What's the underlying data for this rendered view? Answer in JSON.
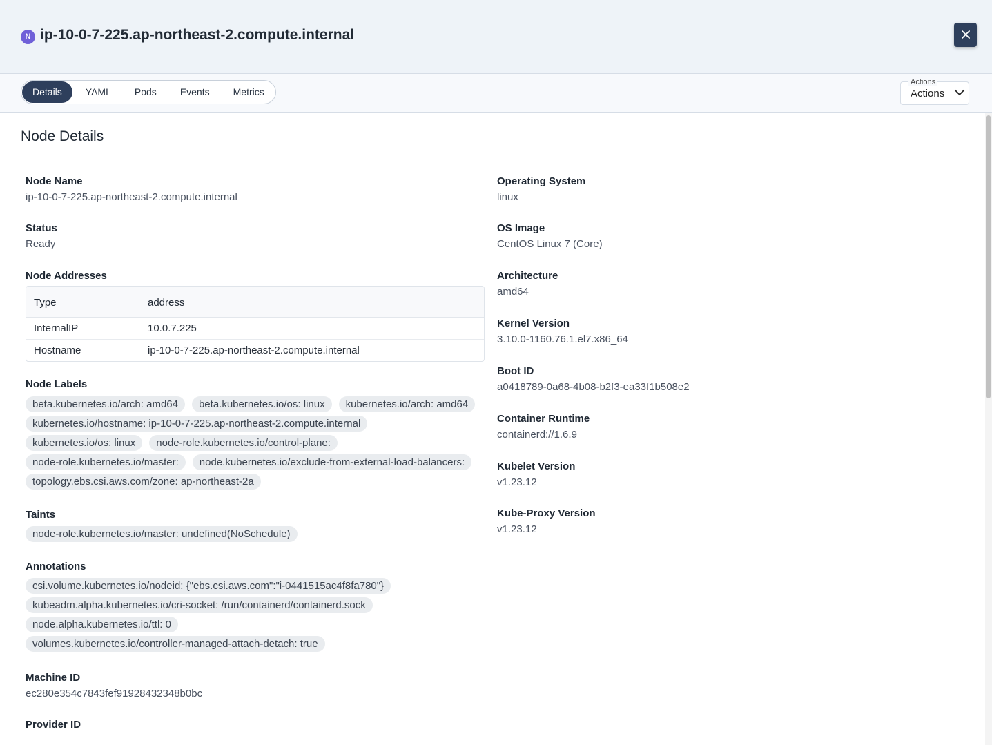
{
  "header": {
    "badge": "N",
    "title": "ip-10-0-7-225.ap-northeast-2.compute.internal",
    "close_icon": "close-icon"
  },
  "tabs": [
    {
      "label": "Details",
      "active": true
    },
    {
      "label": "YAML",
      "active": false
    },
    {
      "label": "Pods",
      "active": false
    },
    {
      "label": "Events",
      "active": false
    },
    {
      "label": "Metrics",
      "active": false
    }
  ],
  "actions": {
    "legend": "Actions",
    "value": "Actions"
  },
  "section_title": "Node Details",
  "left": {
    "node_name": {
      "label": "Node Name",
      "value": "ip-10-0-7-225.ap-northeast-2.compute.internal"
    },
    "status": {
      "label": "Status",
      "value": "Ready"
    },
    "addresses": {
      "label": "Node Addresses",
      "headers": [
        "Type",
        "address"
      ],
      "rows": [
        [
          "InternalIP",
          "10.0.7.225"
        ],
        [
          "Hostname",
          "ip-10-0-7-225.ap-northeast-2.compute.internal"
        ]
      ]
    },
    "labels": {
      "label": "Node Labels",
      "items": [
        "beta.kubernetes.io/arch: amd64",
        "beta.kubernetes.io/os: linux",
        "kubernetes.io/arch: amd64",
        "kubernetes.io/hostname: ip-10-0-7-225.ap-northeast-2.compute.internal",
        "kubernetes.io/os: linux",
        "node-role.kubernetes.io/control-plane:",
        "node-role.kubernetes.io/master:",
        "node.kubernetes.io/exclude-from-external-load-balancers:",
        "topology.ebs.csi.aws.com/zone: ap-northeast-2a"
      ]
    },
    "taints": {
      "label": "Taints",
      "items": [
        "node-role.kubernetes.io/master: undefined(NoSchedule)"
      ]
    },
    "annotations": {
      "label": "Annotations",
      "items": [
        "csi.volume.kubernetes.io/nodeid: {\"ebs.csi.aws.com\":\"i-0441515ac4f8fa780\"}",
        "kubeadm.alpha.kubernetes.io/cri-socket: /run/containerd/containerd.sock",
        "node.alpha.kubernetes.io/ttl: 0",
        "volumes.kubernetes.io/controller-managed-attach-detach: true"
      ]
    },
    "machine_id": {
      "label": "Machine ID",
      "value": "ec280e354c7843fef91928432348b0bc"
    },
    "provider_id": {
      "label": "Provider ID"
    }
  },
  "right": {
    "os": {
      "label": "Operating System",
      "value": "linux"
    },
    "os_image": {
      "label": "OS Image",
      "value": "CentOS Linux 7 (Core)"
    },
    "arch": {
      "label": "Architecture",
      "value": "amd64"
    },
    "kernel": {
      "label": "Kernel Version",
      "value": "3.10.0-1160.76.1.el7.x86_64"
    },
    "boot_id": {
      "label": "Boot ID",
      "value": "a0418789-0a68-4b08-b2f3-ea33f1b508e2"
    },
    "runtime": {
      "label": "Container Runtime",
      "value": "containerd://1.6.9"
    },
    "kubelet": {
      "label": "Kubelet Version",
      "value": "v1.23.12"
    },
    "kube_proxy": {
      "label": "Kube-Proxy Version",
      "value": "v1.23.12"
    }
  }
}
